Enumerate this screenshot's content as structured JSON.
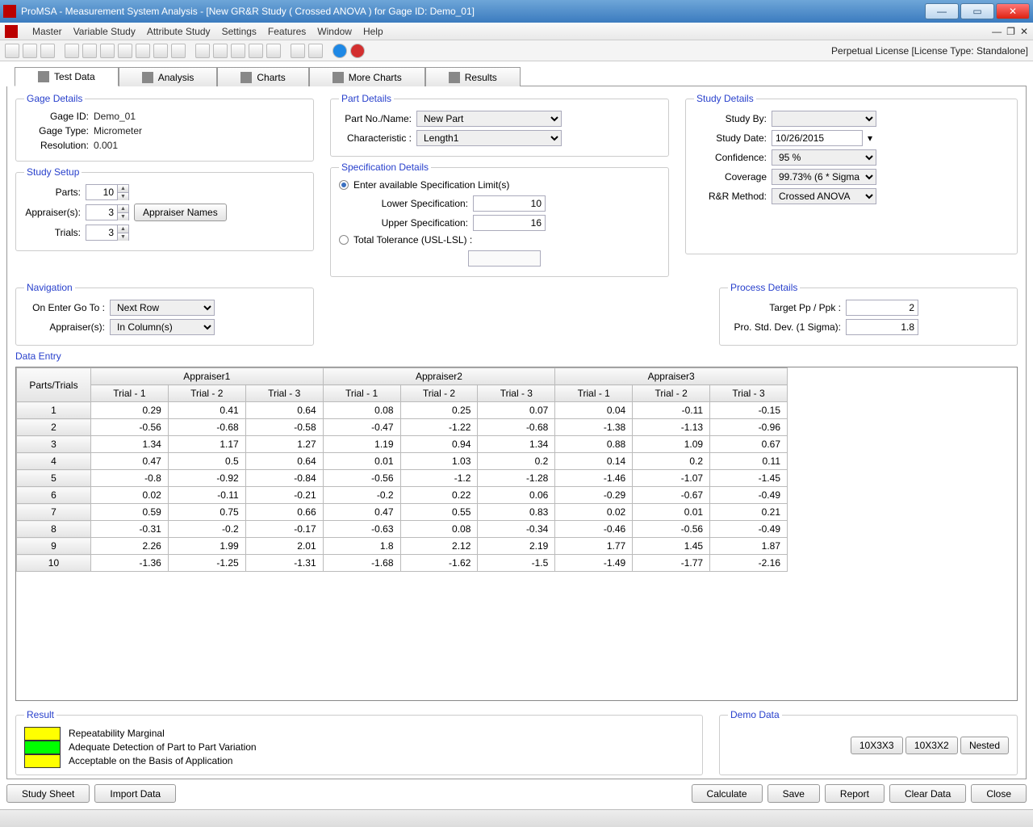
{
  "title": "ProMSA - Measurement System Analysis  -  [New GR&R Study ( Crossed ANOVA ) for Gage ID: Demo_01]",
  "menu": [
    "Master",
    "Variable Study",
    "Attribute Study",
    "Settings",
    "Features",
    "Window",
    "Help"
  ],
  "license": "Perpetual License [License Type: Standalone]",
  "tabs": [
    "Test Data",
    "Analysis",
    "Charts",
    "More Charts",
    "Results"
  ],
  "gage": {
    "legend": "Gage Details",
    "id_label": "Gage ID:",
    "id": "Demo_01",
    "type_label": "Gage Type:",
    "type": "Micrometer",
    "res_label": "Resolution:",
    "res": "0.001"
  },
  "setup": {
    "legend": "Study Setup",
    "parts_label": "Parts:",
    "parts": "10",
    "appr_label": "Appraiser(s):",
    "appr": "3",
    "trials_label": "Trials:",
    "trials": "3",
    "appr_btn": "Appraiser Names"
  },
  "nav": {
    "legend": "Navigation",
    "enter_label": "On Enter Go To :",
    "enter": "Next Row",
    "appr_label": "Appraiser(s):",
    "appr": "In Column(s)"
  },
  "part": {
    "legend": "Part Details",
    "partno_label": "Part No./Name:",
    "partno": "New Part",
    "char_label": "Characteristic :",
    "char": "Length1"
  },
  "spec": {
    "legend": "Specification Details",
    "r1": "Enter available Specification Limit(s)",
    "lsl_label": "Lower Specification:",
    "lsl": "10",
    "usl_label": "Upper Specification:",
    "usl": "16",
    "r2": "Total Tolerance (USL-LSL) :",
    "tot": ""
  },
  "study": {
    "legend": "Study Details",
    "by_label": "Study By:",
    "by": "",
    "date_label": "Study Date:",
    "date": "10/26/2015",
    "conf_label": "Confidence:",
    "conf": "95 %",
    "cov_label": "Coverage",
    "cov": "99.73% (6 * Sigma)",
    "rr_label": "R&R Method:",
    "rr": "Crossed ANOVA"
  },
  "process": {
    "legend": "Process Details",
    "pp_label": "Target Pp / Ppk :",
    "pp": "2",
    "sd_label": "Pro. Std. Dev. (1 Sigma):",
    "sd": "1.8"
  },
  "data": {
    "legend": "Data Entry",
    "appraisers": [
      "Appraiser1",
      "Appraiser2",
      "Appraiser3"
    ],
    "trials": [
      "Trial -  1",
      "Trial -  2",
      "Trial -  3"
    ],
    "rowhead": "Parts/Trials",
    "rows": [
      {
        "p": "1",
        "v": [
          "0.29",
          "0.41",
          "0.64",
          "0.08",
          "0.25",
          "0.07",
          "0.04",
          "-0.11",
          "-0.15"
        ]
      },
      {
        "p": "2",
        "v": [
          "-0.56",
          "-0.68",
          "-0.58",
          "-0.47",
          "-1.22",
          "-0.68",
          "-1.38",
          "-1.13",
          "-0.96"
        ]
      },
      {
        "p": "3",
        "v": [
          "1.34",
          "1.17",
          "1.27",
          "1.19",
          "0.94",
          "1.34",
          "0.88",
          "1.09",
          "0.67"
        ]
      },
      {
        "p": "4",
        "v": [
          "0.47",
          "0.5",
          "0.64",
          "0.01",
          "1.03",
          "0.2",
          "0.14",
          "0.2",
          "0.11"
        ]
      },
      {
        "p": "5",
        "v": [
          "-0.8",
          "-0.92",
          "-0.84",
          "-0.56",
          "-1.2",
          "-1.28",
          "-1.46",
          "-1.07",
          "-1.45"
        ]
      },
      {
        "p": "6",
        "v": [
          "0.02",
          "-0.11",
          "-0.21",
          "-0.2",
          "0.22",
          "0.06",
          "-0.29",
          "-0.67",
          "-0.49"
        ]
      },
      {
        "p": "7",
        "v": [
          "0.59",
          "0.75",
          "0.66",
          "0.47",
          "0.55",
          "0.83",
          "0.02",
          "0.01",
          "0.21"
        ]
      },
      {
        "p": "8",
        "v": [
          "-0.31",
          "-0.2",
          "-0.17",
          "-0.63",
          "0.08",
          "-0.34",
          "-0.46",
          "-0.56",
          "-0.49"
        ]
      },
      {
        "p": "9",
        "v": [
          "2.26",
          "1.99",
          "2.01",
          "1.8",
          "2.12",
          "2.19",
          "1.77",
          "1.45",
          "1.87"
        ]
      },
      {
        "p": "10",
        "v": [
          "-1.36",
          "-1.25",
          "-1.31",
          "-1.68",
          "-1.62",
          "-1.5",
          "-1.49",
          "-1.77",
          "-2.16"
        ]
      }
    ]
  },
  "result": {
    "legend": "Result",
    "lines": [
      "Repeatability Marginal",
      "Adequate Detection of Part to Part Variation",
      "Acceptable on the Basis of Application"
    ],
    "colors": [
      "#ffff00",
      "#00ff00",
      "#ffff00"
    ]
  },
  "demo": {
    "legend": "Demo Data",
    "b1": "10X3X3",
    "b2": "10X3X2",
    "b3": "Nested"
  },
  "bottom": {
    "sheet": "Study Sheet",
    "import": "Import Data",
    "calc": "Calculate",
    "save": "Save",
    "report": "Report",
    "clear": "Clear Data",
    "close": "Close"
  }
}
